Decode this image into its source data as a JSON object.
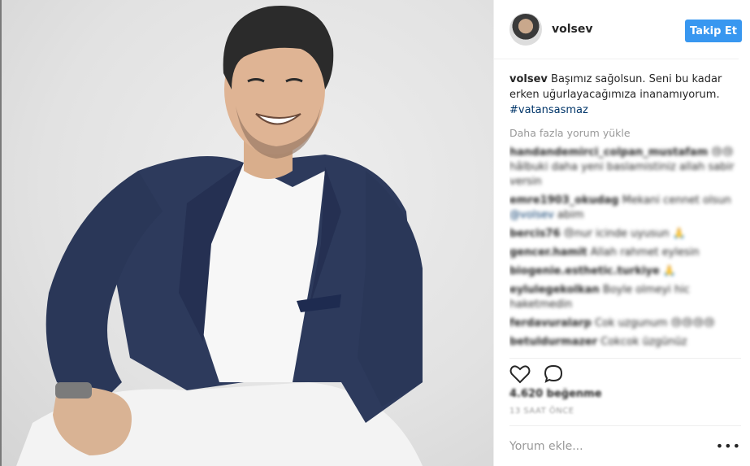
{
  "post": {
    "username": "volsev",
    "follow_label": "Takip Et",
    "caption_user": "volsev",
    "caption_text": "Başımız sağolsun. Seni bu kadar erken uğurlayacağımıza inanamıyorum.",
    "hashtag": "#vatansasmaz",
    "load_more": "Daha fazla yorum yükle"
  },
  "comments": [
    {
      "user": "handandemirci_colpan_mustafam",
      "text": "😢😢 hâlbuki daha yeni baslamistiniz allah sabir versin"
    },
    {
      "user": "emre1903_okudag",
      "text": "Mekani cennet olsun",
      "mention": "@volsev",
      "after": "abim"
    },
    {
      "user": "bercis76",
      "text": "😢nur icinde uyusun 🙏"
    },
    {
      "user": "gencer.hamit",
      "text": "Allah rahmet eylesin"
    },
    {
      "user": "biogenie.esthetic.turkiye",
      "text": "🙏"
    },
    {
      "user": "eylulegekolkan",
      "text": "Boyle olmeyi hic haketmedin"
    },
    {
      "user": "ferdavuralarp",
      "text": "Cok uzgunum 😢😢😢😢"
    },
    {
      "user": "betuldurmazer",
      "text": "Cokcok üzgünüz"
    }
  ],
  "likes": "4.620 beğenme",
  "time_ago": "13 SAAT ÖNCE",
  "add_comment_placeholder": "Yorum ekle...",
  "more_options": "•••"
}
